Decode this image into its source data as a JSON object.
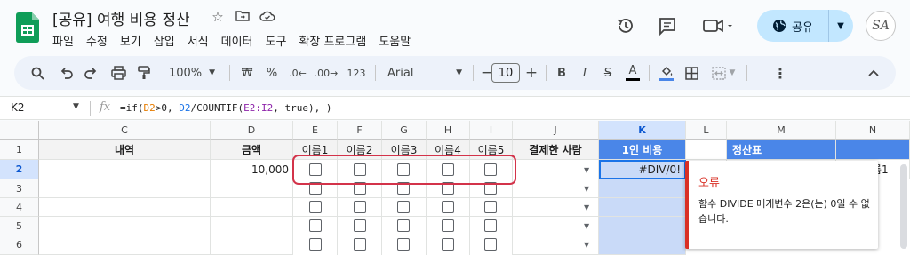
{
  "doc": {
    "title": "[공유] 여행 비용 정산",
    "menu": [
      "파일",
      "수정",
      "보기",
      "삽입",
      "서식",
      "데이터",
      "도구",
      "확장 프로그램",
      "도움말"
    ]
  },
  "share": {
    "label": "공유"
  },
  "avatar": {
    "initials": "SA"
  },
  "toolbar": {
    "zoom": "100%",
    "currency": "₩",
    "percent": "%",
    "dec_decrease": ".0←",
    "dec_increase": ".00→",
    "number_format": "123",
    "font": "Arial",
    "font_size": "10",
    "minus": "−",
    "plus": "+",
    "bold": "B",
    "italic": "I",
    "strike": "S",
    "text_color": "A"
  },
  "formula_bar": {
    "cell_ref": "K2",
    "fx": "fx",
    "formula_parts": {
      "p1": "=if(",
      "p2": "D2",
      "p3": ">0, ",
      "p4": "D2",
      "p5": "/COUNTIF(",
      "p6": "E2:I2",
      "p7": ", ",
      "p8": "true",
      "p9": "), )"
    }
  },
  "columns": [
    "C",
    "D",
    "E",
    "F",
    "G",
    "H",
    "I",
    "J",
    "K",
    "L",
    "M",
    "N"
  ],
  "rows": [
    "1",
    "2",
    "3",
    "4",
    "5",
    "6"
  ],
  "header_row": {
    "C": "내역",
    "D": "금액",
    "E": "이름1",
    "F": "이름2",
    "G": "이름3",
    "H": "이름4",
    "I": "이름5",
    "J": "결제한 사람",
    "K": "1인 비용",
    "M": "정산표"
  },
  "row2": {
    "D": "10,000",
    "K": "#DIV/0!",
    "N_partial": "름1"
  },
  "error_popup": {
    "title": "오류",
    "message": "함수 DIVIDE 매개변수 2은(는) 0일 수 없습니다."
  },
  "colors": {
    "accent": "#0b57d0",
    "header_blue": "#4a86e8",
    "k_fill": "#c9daf8",
    "error_red": "#d93025",
    "highlight": "#d3334a",
    "sheets_green": "#0f9d58"
  }
}
